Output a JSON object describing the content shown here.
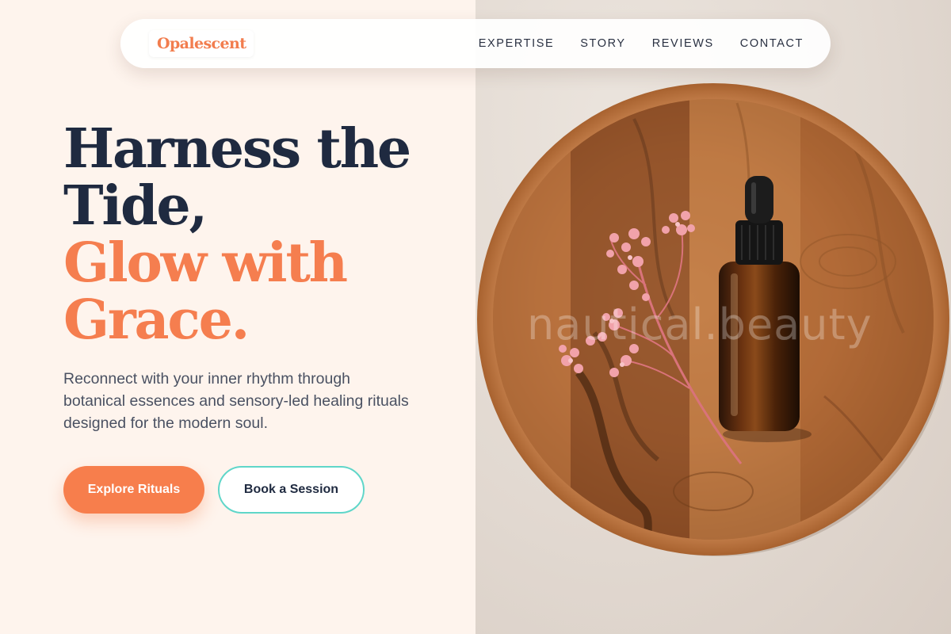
{
  "brand": {
    "name": "Opalescent"
  },
  "nav": {
    "links": [
      {
        "label": "EXPERTISE"
      },
      {
        "label": "STORY"
      },
      {
        "label": "REVIEWS"
      },
      {
        "label": "CONTACT"
      }
    ]
  },
  "hero": {
    "title_line_1": "Harness the",
    "title_line_2": "Tide,",
    "accent_line_1": "Glow with",
    "accent_line_2": "Grace.",
    "subtitle": "Reconnect with your inner rhythm through botanical essences and sensory-led healing rituals designed for the modern soul.",
    "primary_cta": "Explore Rituals",
    "secondary_cta": "Book a Session"
  },
  "image": {
    "watermark": "nautical.beauty"
  },
  "colors": {
    "accent": "#f57e4f",
    "dark": "#1f2a40",
    "outline": "#5fd6c9",
    "background": "#fef4ed"
  }
}
